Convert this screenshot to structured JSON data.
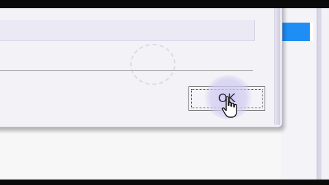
{
  "dialog": {
    "ok_button_label": "OK"
  },
  "icons": {
    "cursor": "hand-pointer-cursor-icon",
    "busy_indicator": "busy-spinner-icon"
  },
  "colors": {
    "selection_blue": "#1e8ef5",
    "dialog_background": "#f3f2f6",
    "click_highlight": "#cdc8f0"
  }
}
